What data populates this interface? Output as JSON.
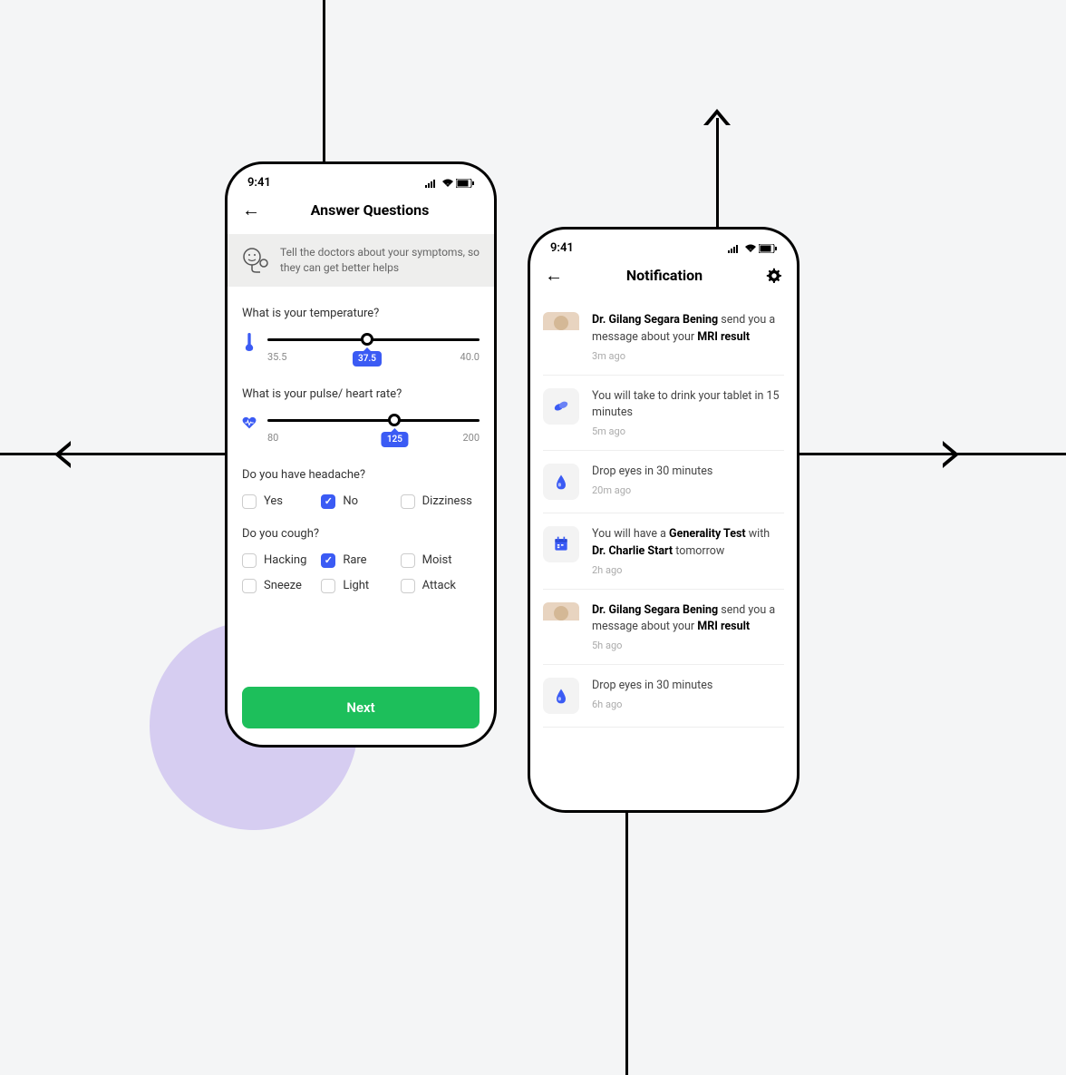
{
  "status_time": "9:41",
  "phone1": {
    "title": "Answer Questions",
    "banner": "Tell the doctors about your symptoms, so they can get better helps",
    "q1": {
      "label": "What is your temperature?",
      "min": "35.5",
      "max": "40.0",
      "value": "37.5",
      "pct": 47
    },
    "q2": {
      "label": "What is your pulse/ heart rate?",
      "min": "80",
      "max": "200",
      "value": "125",
      "pct": 60
    },
    "q3": {
      "label": "Do you have headache?",
      "opts": [
        {
          "l": "Yes",
          "c": false
        },
        {
          "l": "No",
          "c": true
        },
        {
          "l": "Dizziness",
          "c": false
        }
      ]
    },
    "q4": {
      "label": "Do you cough?",
      "opts": [
        {
          "l": "Hacking",
          "c": false
        },
        {
          "l": "Rare",
          "c": true
        },
        {
          "l": "Moist",
          "c": false
        },
        {
          "l": "Sneeze",
          "c": false
        },
        {
          "l": "Light",
          "c": false
        },
        {
          "l": "Attack",
          "c": false
        }
      ]
    },
    "next": "Next"
  },
  "phone2": {
    "title": "Notification",
    "items": [
      {
        "type": "avatar",
        "bold1": "Dr. Gilang Segara Bening",
        "mid": " send you a message about your ",
        "bold2": "MRI result",
        "time": "3m ago"
      },
      {
        "type": "pill",
        "plain": "You will take to drink your tablet in 15 minutes",
        "time": "5m ago"
      },
      {
        "type": "drop",
        "plain": "Drop eyes in 30 minutes",
        "time": "20m ago"
      },
      {
        "type": "cal",
        "pre": "You will have a ",
        "bold1": "Generality Test",
        "mid": " with ",
        "bold2": "Dr. Charlie Start",
        "post": " tomorrow",
        "time": "2h ago"
      },
      {
        "type": "avatar",
        "bold1": "Dr. Gilang Segara Bening",
        "mid": " send you a message about your ",
        "bold2": "MRI result",
        "time": "5h ago"
      },
      {
        "type": "drop",
        "plain": "Drop eyes in 30 minutes",
        "time": "6h ago"
      }
    ]
  }
}
